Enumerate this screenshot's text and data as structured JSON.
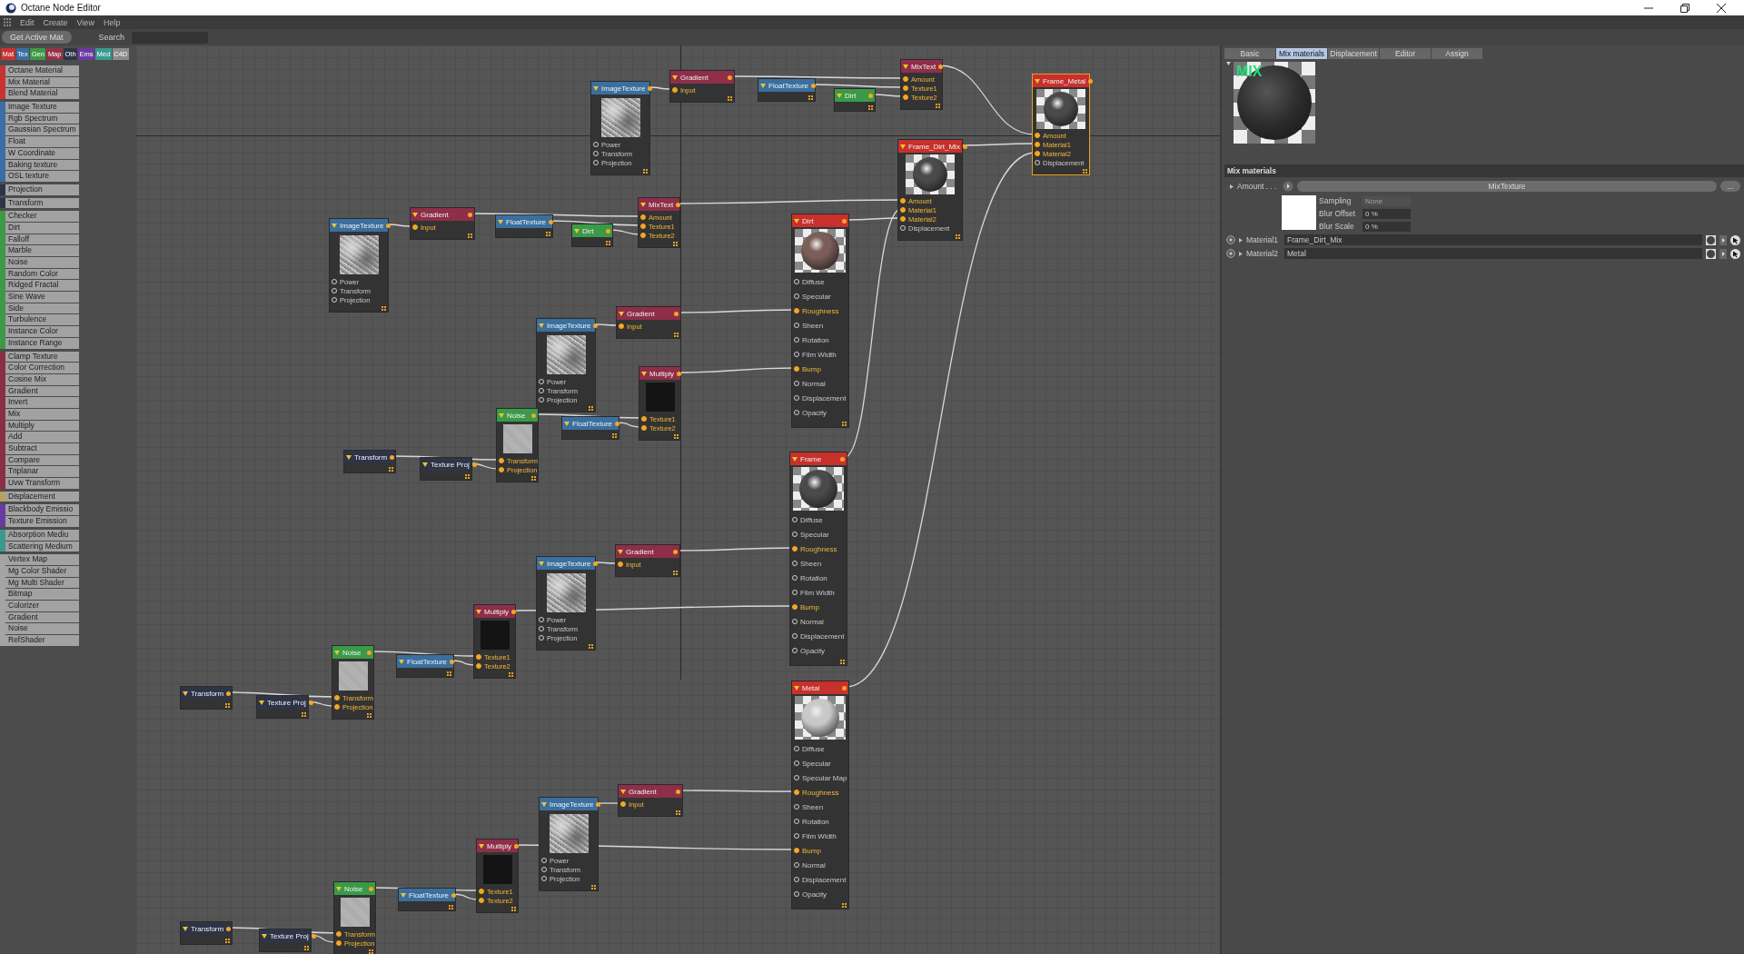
{
  "window": {
    "title": "Octane Node Editor"
  },
  "menu": [
    "Edit",
    "Create",
    "View",
    "Help"
  ],
  "toolbar": {
    "button": "Get Active Mat",
    "search_label": "Search"
  },
  "categories": [
    {
      "label": "Mat",
      "color": "#c83232"
    },
    {
      "label": "Tex",
      "color": "#3a6ea5"
    },
    {
      "label": "Gen",
      "color": "#3c9a46"
    },
    {
      "label": "Map",
      "color": "#963246"
    },
    {
      "label": "Oth",
      "color": "#2e3448"
    },
    {
      "label": "Ems",
      "color": "#6a3aa0"
    },
    {
      "label": "Med",
      "color": "#3a9a8e"
    },
    {
      "label": "C4D",
      "color": "#8c8c8c"
    }
  ],
  "sidebar": {
    "groups": [
      {
        "color": "#c83232",
        "items": [
          "Octane Material",
          "Mix Material",
          "Blend Material"
        ]
      },
      {
        "color": "#3a6ea5",
        "items": [
          "Image Texture",
          "Rgb Spectrum",
          "Gaussian Spectrum",
          "Float",
          "W Coordinate",
          "Baking texture",
          "OSL texture"
        ]
      },
      {
        "color": "#2e3448",
        "items": [
          "Projection"
        ]
      },
      {
        "color": "#2e3448",
        "items": [
          "Transform"
        ]
      },
      {
        "color": "#3c9a46",
        "items": [
          "Checker",
          "Dirt",
          "Falloff",
          "Marble",
          "Noise",
          "Random Color",
          "Ridged Fractal",
          "Sine Wave",
          "Side",
          "Turbulence",
          "Instance Color",
          "Instance Range"
        ]
      },
      {
        "color": "#8a2e48",
        "items": [
          "Clamp Texture",
          "Color Correction",
          "Cosine Mix",
          "Gradient",
          "Invert",
          "Mix",
          "Multiply",
          "Add",
          "Subtract",
          "Compare",
          "Triplanar",
          "Uvw Transform"
        ]
      },
      {
        "color": "#b8a060",
        "items": [
          "Displacement"
        ]
      },
      {
        "color": "#6a3aa0",
        "items": [
          "Blackbody Emissio",
          "Texture Emission"
        ]
      },
      {
        "color": "#3a9a8e",
        "items": [
          "Absorption Mediu",
          "Scattering Medium"
        ]
      },
      {
        "color": "#a4a4a4",
        "items": [
          "Vertex Map",
          "Mg Color Shader",
          "Mg Multi Shader",
          "Bitmap",
          "Colorizer",
          "Gradient",
          "Noise",
          "RefShader"
        ]
      }
    ]
  },
  "nodes": [
    {
      "kind": "image_texture",
      "title": "ImageTexture",
      "selected": false,
      "ports": [
        {
          "label": "Power",
          "connected": false
        },
        {
          "label": "Transform",
          "connected": false
        },
        {
          "label": "Projection",
          "connected": false
        }
      ]
    },
    {
      "kind": "gradient",
      "title": "Gradient",
      "selected": false,
      "ports": [
        {
          "label": "Input",
          "connected": true
        }
      ]
    },
    {
      "kind": "float_texture",
      "title": "FloatTexture",
      "selected": false
    },
    {
      "kind": "dirt_texture",
      "title": "Dirt",
      "selected": false
    },
    {
      "kind": "mix_texture",
      "title": "MixText",
      "selected": false,
      "ports": [
        {
          "label": "Amount",
          "connected": true
        },
        {
          "label": "Texture1",
          "connected": true
        },
        {
          "label": "Texture2",
          "connected": true
        }
      ]
    },
    {
      "kind": "image_texture",
      "title": "ImageTexture",
      "selected": false,
      "ports": [
        {
          "label": "Power",
          "connected": false
        },
        {
          "label": "Transform",
          "connected": false
        },
        {
          "label": "Projection",
          "connected": false
        }
      ]
    },
    {
      "kind": "gradient",
      "title": "Gradient",
      "selected": false,
      "ports": [
        {
          "label": "Input",
          "connected": true
        }
      ]
    },
    {
      "kind": "float_texture",
      "title": "FloatTexture",
      "selected": false
    },
    {
      "kind": "dirt_texture",
      "title": "Dirt",
      "selected": false
    },
    {
      "kind": "mix_texture",
      "title": "MixText",
      "selected": false,
      "ports": [
        {
          "label": "Amount",
          "connected": true
        },
        {
          "label": "Texture1",
          "connected": true
        },
        {
          "label": "Texture2",
          "connected": true
        }
      ]
    },
    {
      "kind": "image_texture",
      "title": "ImageTexture",
      "selected": false,
      "ports": [
        {
          "label": "Power",
          "connected": false
        },
        {
          "label": "Transform",
          "connected": false
        },
        {
          "label": "Projection",
          "connected": false
        }
      ]
    },
    {
      "kind": "gradient",
      "title": "Gradient",
      "selected": false,
      "ports": [
        {
          "label": "Input",
          "connected": true
        }
      ]
    },
    {
      "kind": "transform",
      "title": "Transform",
      "selected": false
    },
    {
      "kind": "transform",
      "title": "Texture Proj",
      "selected": false
    },
    {
      "kind": "noise",
      "title": "Noise",
      "selected": false,
      "ports": [
        {
          "label": "Transform",
          "connected": true
        },
        {
          "label": "Projection",
          "connected": true
        }
      ]
    },
    {
      "kind": "float_texture",
      "title": "FloatTexture",
      "selected": false
    },
    {
      "kind": "multiply",
      "title": "Multiply",
      "selected": false,
      "ports": [
        {
          "label": "Texture1",
          "connected": true
        },
        {
          "label": "Texture2",
          "connected": true
        }
      ]
    },
    {
      "kind": "material",
      "title": "Dirt",
      "color": "#7a5e58",
      "selected": false,
      "ports": [
        {
          "label": "Diffuse",
          "connected": false
        },
        {
          "label": "Specular",
          "connected": false
        },
        {
          "label": "Roughness",
          "connected": true
        },
        {
          "label": "Sheen",
          "connected": false
        },
        {
          "label": "Rotation",
          "connected": false
        },
        {
          "label": "Film Width",
          "connected": false
        },
        {
          "label": "Bump",
          "connected": true
        },
        {
          "label": "Normal",
          "connected": false
        },
        {
          "label": "Displacement",
          "connected": false
        },
        {
          "label": "Opacity",
          "connected": false
        }
      ]
    },
    {
      "kind": "mix_material",
      "title": "Frame_Dirt_Mix",
      "color": "#4a4a4a",
      "selected": false,
      "ports": [
        {
          "label": "Amount",
          "connected": true
        },
        {
          "label": "Material1",
          "connected": true
        },
        {
          "label": "Material2",
          "connected": true
        },
        {
          "label": "Displacement",
          "connected": false
        }
      ]
    },
    {
      "kind": "mix_material",
      "title": "Frame_Metal",
      "color": "#4a4a4a",
      "selected": true,
      "ports": [
        {
          "label": "Amount",
          "connected": true
        },
        {
          "label": "Material1",
          "connected": true
        },
        {
          "label": "Material2",
          "connected": true
        },
        {
          "label": "Displacement",
          "connected": false
        }
      ]
    },
    {
      "kind": "transform",
      "title": "Transform",
      "selected": false
    },
    {
      "kind": "transform",
      "title": "Texture Proj",
      "selected": false
    },
    {
      "kind": "noise",
      "title": "Noise",
      "selected": false,
      "ports": [
        {
          "label": "Transform",
          "connected": true
        },
        {
          "label": "Projection",
          "connected": true
        }
      ]
    },
    {
      "kind": "float_texture",
      "title": "FloatTexture",
      "selected": false
    },
    {
      "kind": "multiply",
      "title": "Multiply",
      "selected": false,
      "ports": [
        {
          "label": "Texture1",
          "connected": true
        },
        {
          "label": "Texture2",
          "connected": true
        }
      ]
    },
    {
      "kind": "image_texture",
      "title": "ImageTexture",
      "selected": false,
      "ports": [
        {
          "label": "Power",
          "connected": false
        },
        {
          "label": "Transform",
          "connected": false
        },
        {
          "label": "Projection",
          "connected": false
        }
      ]
    },
    {
      "kind": "gradient",
      "title": "Gradient",
      "selected": false,
      "ports": [
        {
          "label": "Input",
          "connected": true
        }
      ]
    },
    {
      "kind": "material",
      "title": "Frame",
      "color": "#4a4a4a",
      "selected": false,
      "ports": [
        {
          "label": "Diffuse",
          "connected": false
        },
        {
          "label": "Specular",
          "connected": false
        },
        {
          "label": "Roughness",
          "connected": true
        },
        {
          "label": "Sheen",
          "connected": false
        },
        {
          "label": "Rotation",
          "connected": false
        },
        {
          "label": "Film Width",
          "connected": false
        },
        {
          "label": "Bump",
          "connected": true
        },
        {
          "label": "Normal",
          "connected": false
        },
        {
          "label": "Displacement",
          "connected": false
        },
        {
          "label": "Opacity",
          "connected": false
        }
      ]
    },
    {
      "kind": "transform",
      "title": "Transform",
      "selected": false
    },
    {
      "kind": "transform",
      "title": "Texture Proj",
      "selected": false
    },
    {
      "kind": "noise",
      "title": "Noise",
      "selected": false,
      "ports": [
        {
          "label": "Transform",
          "connected": true
        },
        {
          "label": "Projection",
          "connected": true
        }
      ]
    },
    {
      "kind": "float_texture",
      "title": "FloatTexture",
      "selected": false
    },
    {
      "kind": "multiply",
      "title": "Multiply",
      "selected": false,
      "ports": [
        {
          "label": "Texture1",
          "connected": true
        },
        {
          "label": "Texture2",
          "connected": true
        }
      ]
    },
    {
      "kind": "image_texture",
      "title": "ImageTexture",
      "selected": false,
      "ports": [
        {
          "label": "Power",
          "connected": false
        },
        {
          "label": "Transform",
          "connected": false
        },
        {
          "label": "Projection",
          "connected": false
        }
      ]
    },
    {
      "kind": "gradient",
      "title": "Gradient",
      "selected": false,
      "ports": [
        {
          "label": "Input",
          "connected": true
        }
      ]
    },
    {
      "kind": "material",
      "title": "Metal",
      "color": "#c8c8c8",
      "selected": false,
      "ports": [
        {
          "label": "Diffuse",
          "connected": false
        },
        {
          "label": "Specular",
          "connected": false
        },
        {
          "label": "Specular Map",
          "connected": false
        },
        {
          "label": "Roughness",
          "connected": true
        },
        {
          "label": "Sheen",
          "connected": false
        },
        {
          "label": "Rotation",
          "connected": false
        },
        {
          "label": "Film Width",
          "connected": false
        },
        {
          "label": "Bump",
          "connected": true
        },
        {
          "label": "Normal",
          "connected": false
        },
        {
          "label": "Displacement",
          "connected": false
        },
        {
          "label": "Opacity",
          "connected": false
        }
      ]
    }
  ],
  "panel": {
    "tabs": [
      {
        "label": "Basic",
        "selected": false
      },
      {
        "label": "Mix materials",
        "selected": true
      },
      {
        "label": "Displacement",
        "selected": false
      },
      {
        "label": "Editor",
        "selected": false
      },
      {
        "label": "Assign",
        "selected": false
      }
    ],
    "preview_label": "MIX",
    "section": "Mix materials",
    "amount": {
      "label": "Amount . . .",
      "texture": "MixTexture",
      "more": "..."
    },
    "sampling": {
      "label": "Sampling",
      "value": "None",
      "disabled": true
    },
    "blur_offset": {
      "label": "Blur Offset",
      "value": "0 %"
    },
    "blur_scale": {
      "label": "Blur Scale",
      "value": "0 %"
    },
    "materials": [
      {
        "label": "Material1",
        "value": "Frame_Dirt_Mix"
      },
      {
        "label": "Material2",
        "value": "Metal"
      }
    ]
  }
}
